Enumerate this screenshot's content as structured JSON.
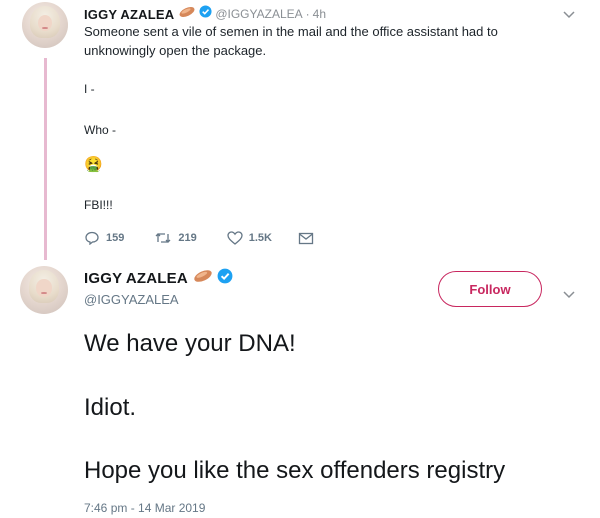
{
  "tweet1": {
    "display_name": "IGGY AZALEA",
    "handle": "@IGGYAZALEA",
    "separator": "·",
    "time": "4h",
    "text": "Someone sent a vile of semen in the mail and the office assistant had to unknowingly open the package.",
    "line_i": "I -",
    "line_who": "Who -",
    "emoji": "🤮",
    "line_fbi": "FBI!!!",
    "reply_count": "159",
    "retweet_count": "219",
    "like_count": "1.5K",
    "icons": [
      "reply-icon",
      "retweet-icon",
      "like-icon",
      "dm-icon",
      "chevron-down-icon"
    ]
  },
  "tweet2": {
    "display_name": "IGGY AZALEA",
    "handle": "@IGGYAZALEA",
    "follow_label": "Follow",
    "line1": "We have your DNA!",
    "line2": "Idiot.",
    "line3": "Hope you like the sex offenders registry",
    "timestamp": "7:46 pm - 14 Mar 2019"
  },
  "colors": {
    "thread_line": "#e7b9d0",
    "follow_accent": "#c8275f",
    "verified": "#1da1f2",
    "muted": "#657786"
  }
}
